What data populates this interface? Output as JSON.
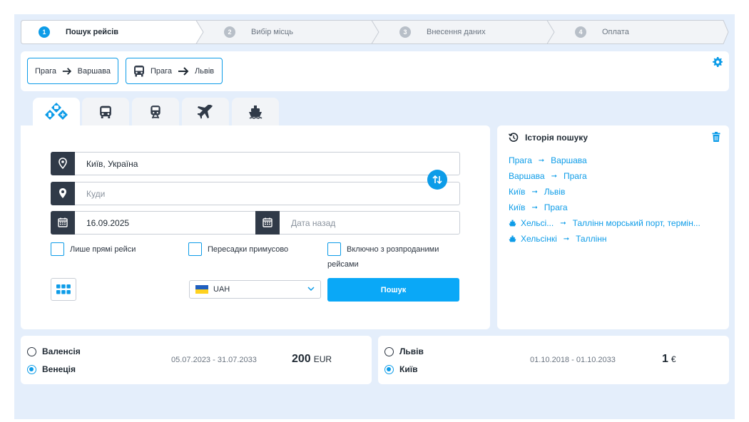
{
  "stepper": {
    "steps": [
      {
        "num": "1",
        "label": "Пошук рейсів"
      },
      {
        "num": "2",
        "label": "Вибір місць"
      },
      {
        "num": "3",
        "label": "Внесення даних"
      },
      {
        "num": "4",
        "label": "Оплата"
      }
    ]
  },
  "saved_routes": [
    {
      "from": "Прага",
      "to": "Варшава"
    },
    {
      "from": "Прага",
      "to": "Львів"
    }
  ],
  "search": {
    "from_value": "Київ, Україна",
    "to_placeholder": "Куди",
    "date_value": "16.09.2025",
    "return_placeholder": "Дата назад",
    "direct_only": "Лише прямі рейси",
    "forced_transfers": "Пересадки примусово",
    "include_sold_out_line1": "Включно з розпроданими",
    "include_sold_out_line2": "рейсами",
    "currency": "UAH",
    "search_button": "Пошук"
  },
  "history": {
    "title": "Історія пошуку",
    "items": [
      {
        "from": "Прага",
        "to": "Варшава",
        "ship": false
      },
      {
        "from": "Варшава",
        "to": "Прага",
        "ship": false
      },
      {
        "from": "Київ",
        "to": "Львів",
        "ship": false
      },
      {
        "from": "Київ",
        "to": "Прага",
        "ship": false
      },
      {
        "from": "Хельсі...",
        "to": "Таллінн морський порт, термін...",
        "ship": true
      },
      {
        "from": "Хельсінкі",
        "to": "Таллінн",
        "ship": true
      }
    ]
  },
  "offers": [
    {
      "city_a": "Валенсія",
      "city_b": "Венеція",
      "dates": "05.07.2023 - 31.07.2033",
      "amount": "200",
      "currency": "EUR"
    },
    {
      "city_a": "Львів",
      "city_b": "Київ",
      "dates": "01.10.2018 - 01.10.2033",
      "amount": "1",
      "currency": "€"
    }
  ],
  "colors": {
    "accent": "#0d9ce8",
    "dark": "#303a48",
    "background": "#e4eefb"
  }
}
